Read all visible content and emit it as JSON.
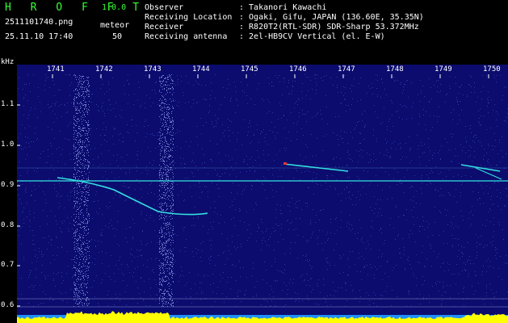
{
  "header": {
    "app_title": "H R O F F T",
    "app_version": "1.0.0",
    "filename": "2511101740.png",
    "datetime": "25.11.10 17:40",
    "meteor_label": "meteor",
    "meteor_count": "50",
    "info": [
      {
        "key": "Observer",
        "value": ": Takanori Kawachi"
      },
      {
        "key": "Receiving Location",
        "value": ": Ogaki, Gifu, JAPAN (136.60E, 35.35N)"
      },
      {
        "key": "Receiver",
        "value": ": R820T2(RTL-SDR) SDR-Sharp 53.372MHz"
      },
      {
        "key": "Receiving antenna",
        "value": ": 2el-HB9CV Vertical (el. E-W)"
      }
    ]
  },
  "spectrogram": {
    "unit_label": "kHz",
    "x_ticks": [
      "1741",
      "1742",
      "1743",
      "1744",
      "1745",
      "1746",
      "1747",
      "1748",
      "1749",
      "1750"
    ],
    "y_ticks": [
      "1.1",
      "1.0",
      "0.9",
      "0.8",
      "0.7",
      "0.6"
    ],
    "colors": {
      "background": "#0b0c6e",
      "noise": "#4d5bd6",
      "trace": "#33e0e0",
      "hot": "#ff3030",
      "level": "#ffff00"
    }
  }
}
